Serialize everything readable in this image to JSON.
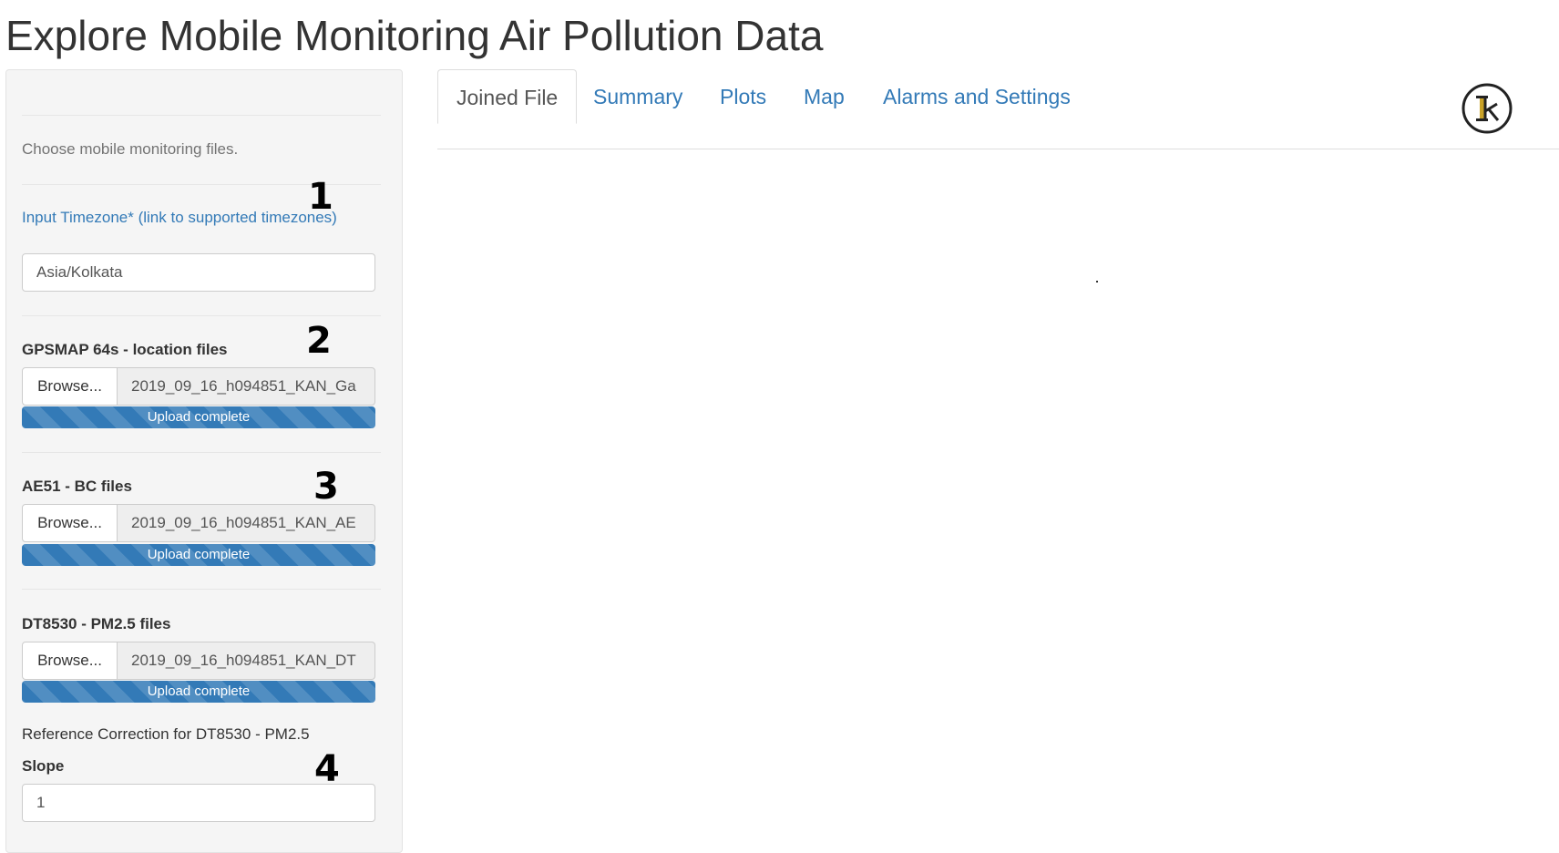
{
  "header": {
    "title": "Explore Mobile Monitoring Air Pollution Data"
  },
  "sidebar": {
    "help_text": "Choose mobile monitoring files.",
    "timezone_link": "Input Timezone* (link to supported timezones)",
    "timezone_value": "Asia/Kolkata",
    "files": [
      {
        "label": "GPSMAP 64s - location files",
        "browse": "Browse...",
        "filename": "2019_09_16_h094851_KAN_Ga",
        "progress_text": "Upload complete",
        "progress_fraction": 1.0
      },
      {
        "label": "AE51 - BC files",
        "browse": "Browse...",
        "filename": "2019_09_16_h094851_KAN_AE",
        "progress_text": "Upload complete",
        "progress_fraction": 1.0
      },
      {
        "label": "DT8530 - PM2.5 files",
        "browse": "Browse...",
        "filename": "2019_09_16_h094851_KAN_DT",
        "progress_text": "Upload complete",
        "progress_fraction": 1.0
      }
    ],
    "reference_correction": "Reference Correction for DT8530 - PM2.5",
    "slope_label": "Slope",
    "slope_value": "1"
  },
  "steps": [
    "1",
    "2",
    "3",
    "4"
  ],
  "tabs": [
    {
      "label": "Joined File",
      "active": true
    },
    {
      "label": "Summary",
      "active": false
    },
    {
      "label": "Plots",
      "active": false
    },
    {
      "label": "Map",
      "active": false
    },
    {
      "label": "Alarms and Settings",
      "active": false
    }
  ],
  "logo": {
    "icon": "ilk-logo-icon",
    "letters": "Ik",
    "accent_color": "#c9a227"
  },
  "colors": {
    "link": "#337ab7",
    "progress": "#337ab7",
    "sidebar_bg": "#f5f5f5"
  }
}
